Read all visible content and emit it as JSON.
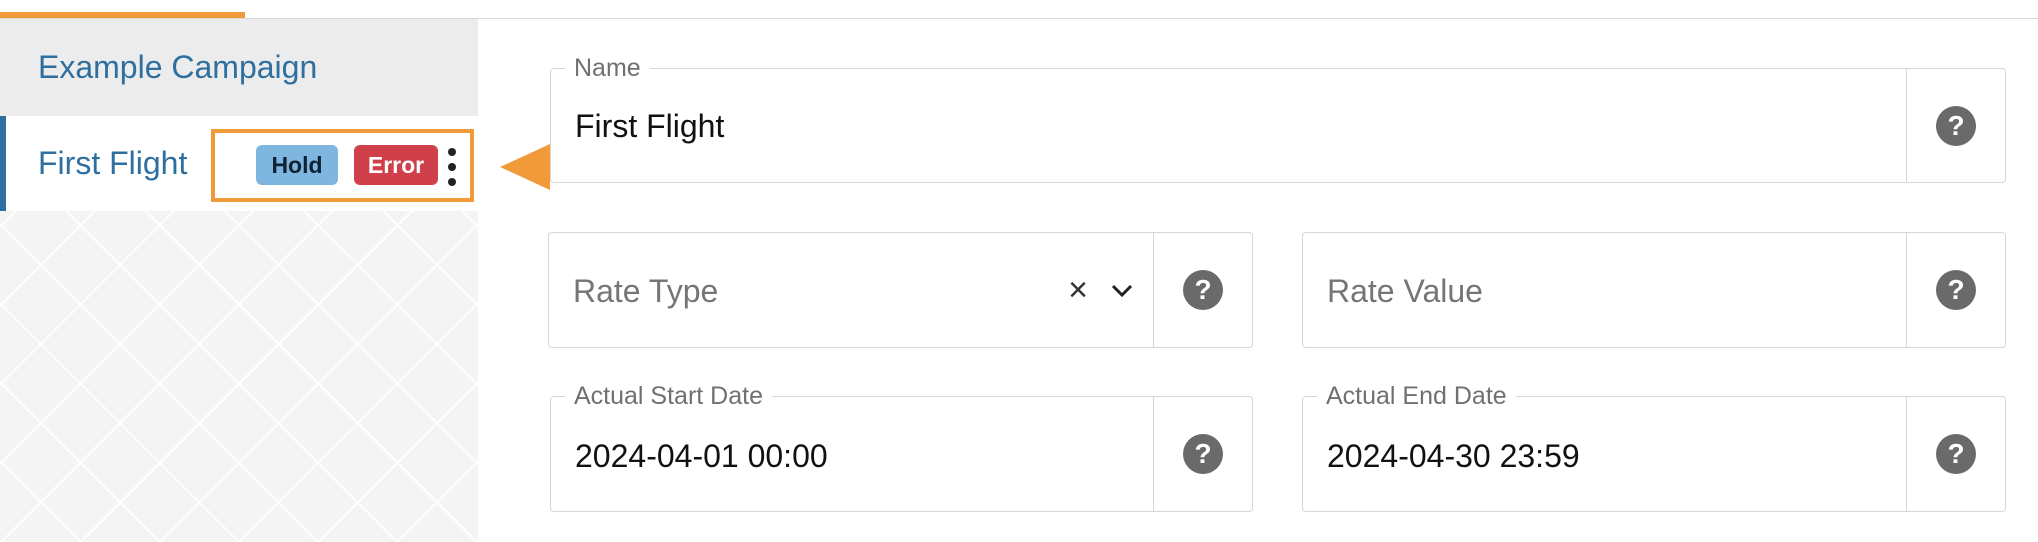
{
  "top": {
    "active_tab_color": "#f09a3a"
  },
  "sidebar": {
    "campaign_label": "Example Campaign",
    "flight": {
      "label": "First Flight",
      "badges": {
        "hold": "Hold",
        "error": "Error"
      },
      "menu_icon": "kebab-menu-icon"
    }
  },
  "annotation": {
    "color": "#f09a3a",
    "arrow_icon": "arrow-left-icon"
  },
  "form": {
    "name": {
      "label": "Name",
      "value": "First Flight"
    },
    "rate_type": {
      "placeholder": "Rate Type",
      "clear_symbol": "×"
    },
    "rate_value": {
      "placeholder": "Rate Value"
    },
    "actual_start_date": {
      "label": "Actual Start Date",
      "value": "2024-04-01 00:00"
    },
    "actual_end_date": {
      "label": "Actual End Date",
      "value": "2024-04-30 23:59"
    },
    "help_symbol": "?"
  },
  "colors": {
    "link": "#2e6fa0",
    "hold_badge": "#7fb6e0",
    "error_badge": "#d0404a",
    "help_icon": "#6a6a6a"
  }
}
